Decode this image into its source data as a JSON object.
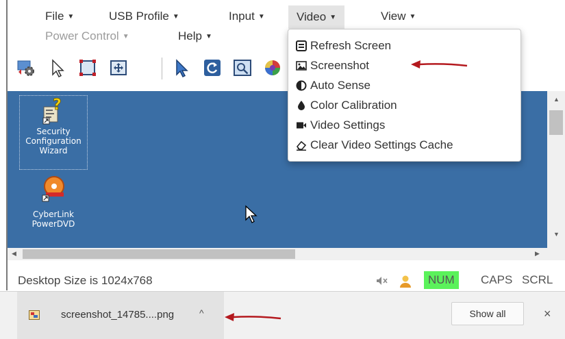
{
  "menubar": {
    "items": [
      {
        "label": "File",
        "state": "normal"
      },
      {
        "label": "USB Profile",
        "state": "normal"
      },
      {
        "label": "Input",
        "state": "normal"
      },
      {
        "label": "Video",
        "state": "active"
      },
      {
        "label": "View",
        "state": "normal"
      },
      {
        "label": "Power Control",
        "state": "disabled"
      },
      {
        "label": "Help",
        "state": "normal"
      }
    ]
  },
  "video_menu": {
    "items": [
      {
        "label": "Refresh Screen",
        "icon": "refresh-screen-icon"
      },
      {
        "label": "Screenshot",
        "icon": "image-icon"
      },
      {
        "label": "Auto Sense",
        "icon": "half-circle-icon"
      },
      {
        "label": "Color Calibration",
        "icon": "drop-icon"
      },
      {
        "label": "Video Settings",
        "icon": "video-camera-icon"
      },
      {
        "label": "Clear Video Settings Cache",
        "icon": "eraser-icon"
      }
    ]
  },
  "toolbar": {
    "tools": [
      "settings-gear-icon",
      "pointer-icon",
      "fit-screen-icon",
      "resize-window-icon",
      "single-cursor-icon",
      "refresh-icon",
      "zoom-icon",
      "color-wheel-icon"
    ]
  },
  "desktop": {
    "background": "#3a6ea5",
    "icons": [
      {
        "label_lines": [
          "Security",
          "Configuration",
          "Wizard"
        ]
      },
      {
        "label_lines": [
          "CyberLink",
          "PowerDVD"
        ]
      }
    ]
  },
  "status": {
    "desktop_size": "Desktop Size is 1024x768",
    "num": "NUM",
    "caps": "CAPS",
    "scrl": "SCRL",
    "num_active_color": "#5bf25b"
  },
  "download_bar": {
    "filename": "screenshot_14785....png",
    "show_all": "Show all",
    "close": "×"
  },
  "annotation_color": "#b4191e"
}
